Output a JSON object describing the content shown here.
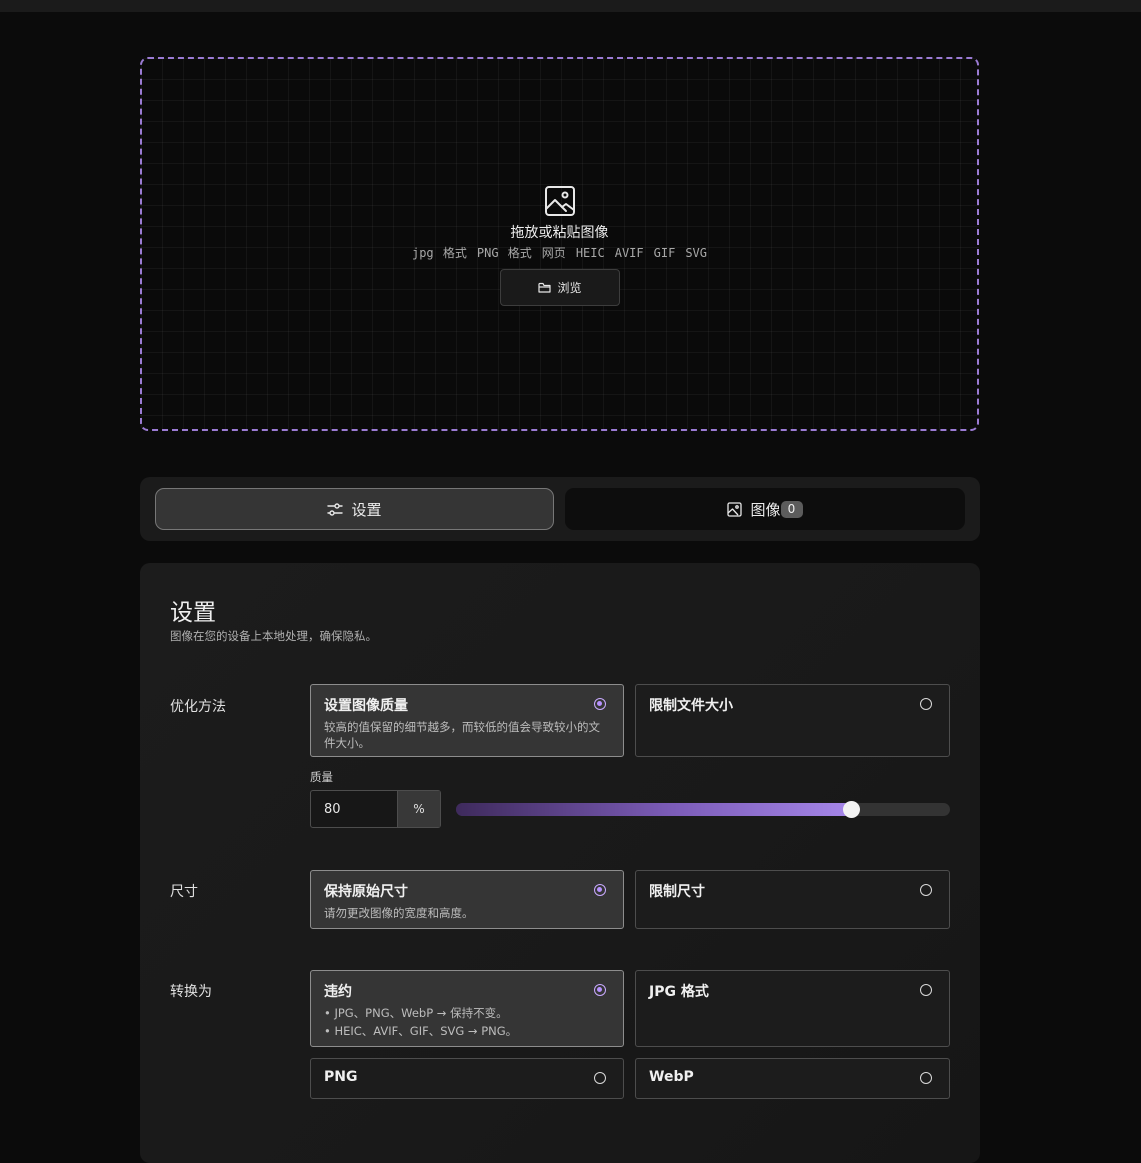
{
  "dropzone": {
    "icon": "image-icon",
    "title": "拖放或粘贴图像",
    "formats": [
      "jpg 格式",
      "PNG 格式",
      "网页",
      "HEIC",
      "AVIF",
      "GIF",
      "SVG"
    ],
    "browse_label": "浏览",
    "browse_icon": "folder-icon",
    "border_color": "#9b7bd4"
  },
  "tabs": [
    {
      "label": "设置",
      "icon": "sliders-icon",
      "active": true
    },
    {
      "label": "图像",
      "icon": "image-icon",
      "count": "0",
      "active": false
    }
  ],
  "settings": {
    "title": "设置",
    "subtitle": "图像在您的设备上本地处理，确保隐私。",
    "optimization": {
      "label": "优化方法",
      "options": [
        {
          "title": "设置图像质量",
          "desc": "较高的值保留的细节越多，而较低的值会导致较小的文件大小。",
          "selected": true
        },
        {
          "title": "限制文件大小",
          "desc": "",
          "selected": false
        }
      ],
      "quality_label": "质量",
      "quality_value": "80",
      "quality_unit": "%",
      "quality_percent": 80
    },
    "size": {
      "label": "尺寸",
      "options": [
        {
          "title": "保持原始尺寸",
          "desc": "请勿更改图像的宽度和高度。",
          "selected": true
        },
        {
          "title": "限制尺寸",
          "desc": "",
          "selected": false
        }
      ]
    },
    "convert": {
      "label": "转换为",
      "options": [
        {
          "title": "违约",
          "desc_lines": [
            "• JPG、PNG、WebP → 保持不变。",
            "• HEIC、AVIF、GIF、SVG → PNG。"
          ],
          "selected": true
        },
        {
          "title": "JPG 格式",
          "selected": false
        },
        {
          "title": "PNG",
          "selected": false
        },
        {
          "title": "WebP",
          "selected": false
        }
      ]
    }
  },
  "accent_color": "#a586e8"
}
